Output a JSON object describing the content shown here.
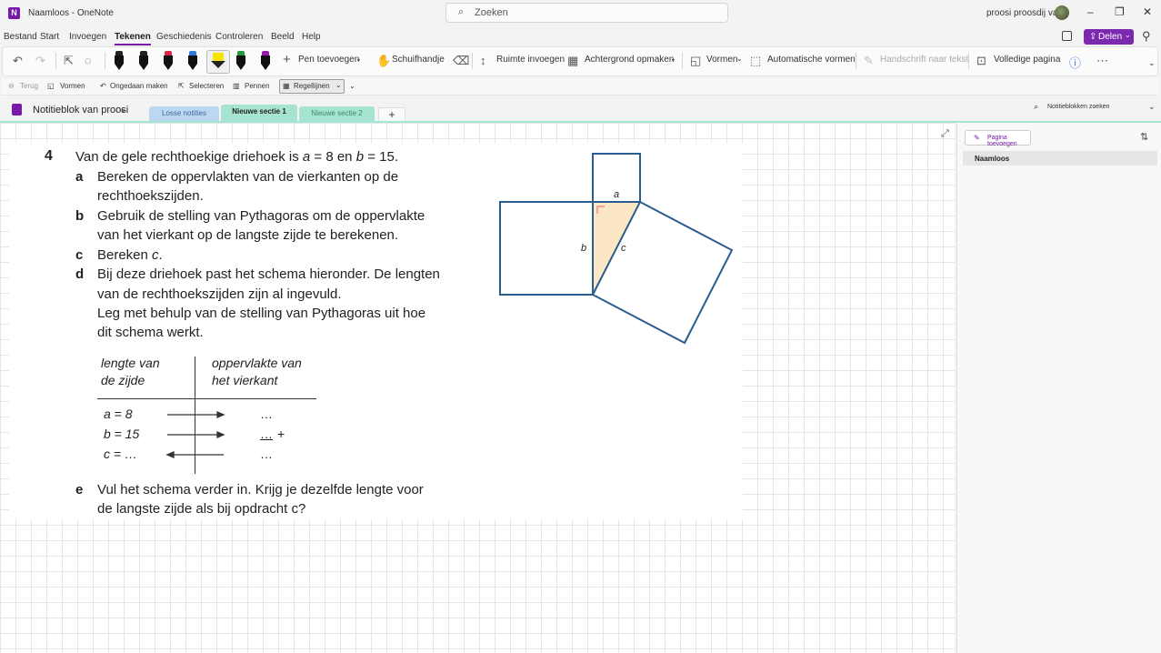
{
  "window": {
    "title": "Naamloos - OneNote",
    "search_icon": "search-icon",
    "search_placeholder": "Zoeken",
    "user": "proosi proosdij van",
    "controls": [
      "–",
      "❐",
      "✕"
    ]
  },
  "menu": {
    "items": [
      "Bestand",
      "Start",
      "Invoegen",
      "Tekenen",
      "Geschiedenis",
      "Controleren",
      "Beeld",
      "Help"
    ],
    "active": "Tekenen",
    "share_label": "Delen"
  },
  "ribbon": {
    "pen_colors": [
      "#222222",
      "#222222",
      "#d9264a",
      "#2c7bd9",
      "#f4e400",
      "#1f9a3a",
      "#9c1aa8"
    ],
    "pen_toevoegen": "Pen toevoegen",
    "schuifhandje": "Schuifhandje",
    "ruimte_invoegen": "Ruimte invoegen",
    "achtergrond_opmaken": "Achtergrond opmaken",
    "vormen": "Vormen",
    "automatische_vormen": "Automatische vormen",
    "handschrift_naar_tekst": "Handschrift naar tekst",
    "volledige_pagina": "Volledige pagina"
  },
  "quick_access": {
    "terug": "Terug",
    "vormen": "Vormen",
    "ongedaan_maken": "Ongedaan maken",
    "selecteren": "Selecteren",
    "pennen": "Pennen",
    "regellijnen": "Regellijnen"
  },
  "notebook": {
    "name": "Notitieblok van proosi",
    "sections": [
      {
        "label": "Losse notities",
        "color": "#bcd7f2"
      },
      {
        "label": "Nieuwe sectie 1",
        "color": "#a6e3d1"
      },
      {
        "label": "Nieuwe sectie 2",
        "color": "#a6e3d1"
      }
    ],
    "active_section": "Nieuwe sectie 1",
    "add_section": "+",
    "search_placeholder": "Notitieblokken zoeken"
  },
  "content": {
    "number": "4",
    "intro_pre": "Van de gele rechthoekige driehoek is ",
    "intro_a": "a",
    "intro_mid1": " = 8 en ",
    "intro_b": "b",
    "intro_mid2": " = 15.",
    "parts": {
      "a_letter": "a",
      "a_line1": "Bereken de oppervlakten van de vierkanten op de",
      "a_line2": "rechthoekszijden.",
      "b_letter": "b",
      "b_line1": "Gebruik de stelling van Pythagoras om de oppervlakte",
      "b_line2": "van het vierkant op de langste zijde te berekenen.",
      "c_letter": "c",
      "c_pre": "Bereken ",
      "c_var": "c",
      "c_post": ".",
      "d_letter": "d",
      "d_line1": "Bij deze driehoek past het schema hieronder. De lengten",
      "d_line2": "van de rechthoekszijden zijn al ingevuld.",
      "d_line3": "Leg met behulp van de stelling van Pythagoras uit hoe",
      "d_line4": "dit schema werkt.",
      "e_letter": "e",
      "e_line1": "Vul het schema verder in. Krijg je dezelfde lengte voor",
      "e_line2": "de langste zijde als bij opdracht c?"
    },
    "table": {
      "head_left_1": "lengte van",
      "head_left_2": "de zijde",
      "head_right_1": "oppervlakte van",
      "head_right_2": "het vierkant",
      "rows": [
        {
          "left": "a = 8",
          "right": "…",
          "suffix": ""
        },
        {
          "left": "b = 15",
          "right": "…",
          "suffix": "+"
        },
        {
          "left": "c = …",
          "right": "…",
          "suffix": ""
        }
      ]
    },
    "figure": {
      "label_a": "a",
      "label_b": "b",
      "label_c": "c",
      "triangle_fill": "#fbe7c4",
      "stroke": "#2a5d8f"
    }
  },
  "pages_panel": {
    "add_page": "Pagina toevoegen",
    "pages": [
      "Naamloos"
    ]
  }
}
